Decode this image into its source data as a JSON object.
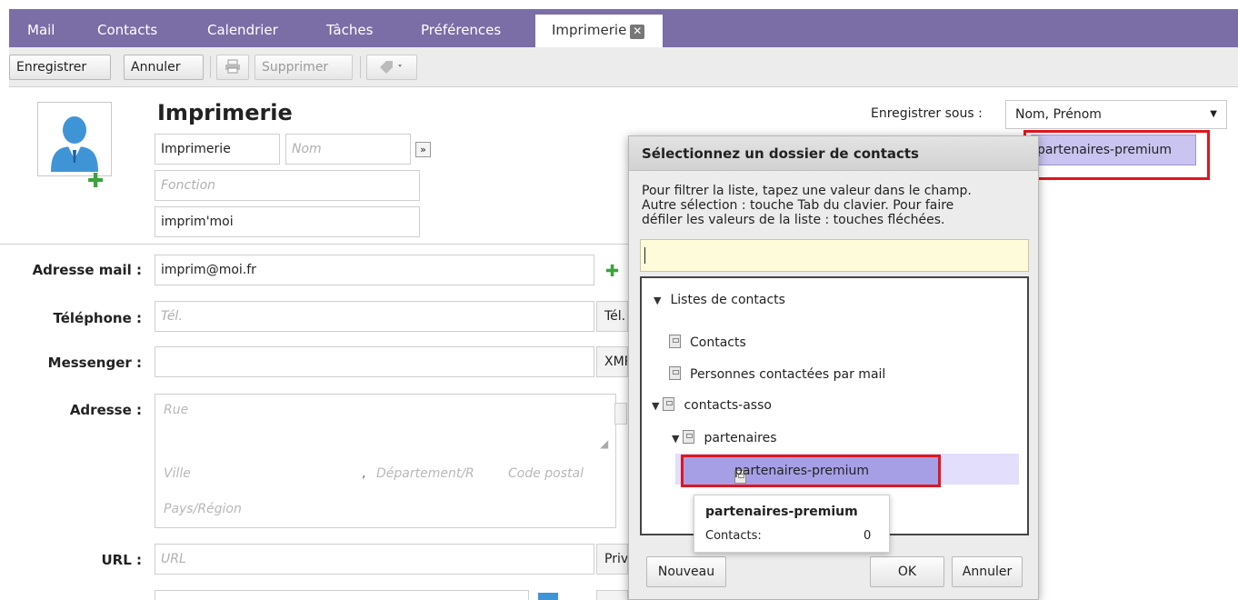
{
  "tabs": [
    {
      "label": "Mail"
    },
    {
      "label": "Contacts"
    },
    {
      "label": "Calendrier"
    },
    {
      "label": "Tâches"
    },
    {
      "label": "Préférences"
    }
  ],
  "active_tab": {
    "label": "Imprimerie",
    "close_icon": "close-icon"
  },
  "toolbar": {
    "save_label": "Enregistrer",
    "cancel_label": "Annuler",
    "print_icon": "print-icon",
    "delete_label": "Supprimer",
    "tag_icon": "tag-icon"
  },
  "contact": {
    "heading": "Imprimerie",
    "first_name": "Imprimerie",
    "last_name_placeholder": "Nom",
    "expand_label": "»",
    "function_placeholder": "Fonction",
    "company": "imprim'moi",
    "save_as_label": "Enregistrer sous :",
    "save_as_value": "Nom, Prénom",
    "folder_button": "partenaires-premium"
  },
  "fields": {
    "email_label": "Adresse mail :",
    "email_value": "imprim@moi.fr",
    "phone_label": "Téléphone :",
    "phone_placeholder": "Tél.",
    "phone_type": "Tél.",
    "messenger_label": "Messenger :",
    "messenger_type": "XMPP",
    "address_label": "Adresse :",
    "street_placeholder": "Rue",
    "city_placeholder": "Ville",
    "comma": ",",
    "region_placeholder": "Département/R",
    "postal_placeholder": "Code postal",
    "country_placeholder": "Pays/Région",
    "url_label": "URL :",
    "url_placeholder": "URL",
    "url_type": "Privé"
  },
  "dialog": {
    "title": "Sélectionnez un dossier de contacts",
    "help_line1": "Pour filtrer la liste, tapez une valeur dans le champ.",
    "help_line2": "Autre sélection : touche Tab du clavier. Pour faire",
    "help_line3": "défiler les valeurs de la liste : touches fléchées.",
    "tree": {
      "root": "Listes de contacts",
      "contacts": "Contacts",
      "mailed": "Personnes contactées par mail",
      "asso": "contacts-asso",
      "partners": "partenaires",
      "premium": "partenaires-premium"
    },
    "tooltip": {
      "name": "partenaires-premium",
      "count_label": "Contacts:",
      "count_value": "0"
    },
    "new_label": "Nouveau",
    "ok_label": "OK",
    "cancel_label": "Annuler"
  },
  "colors": {
    "accent": "#7b6da6",
    "highlight": "#e0161e",
    "selection": "#a79fe6"
  }
}
